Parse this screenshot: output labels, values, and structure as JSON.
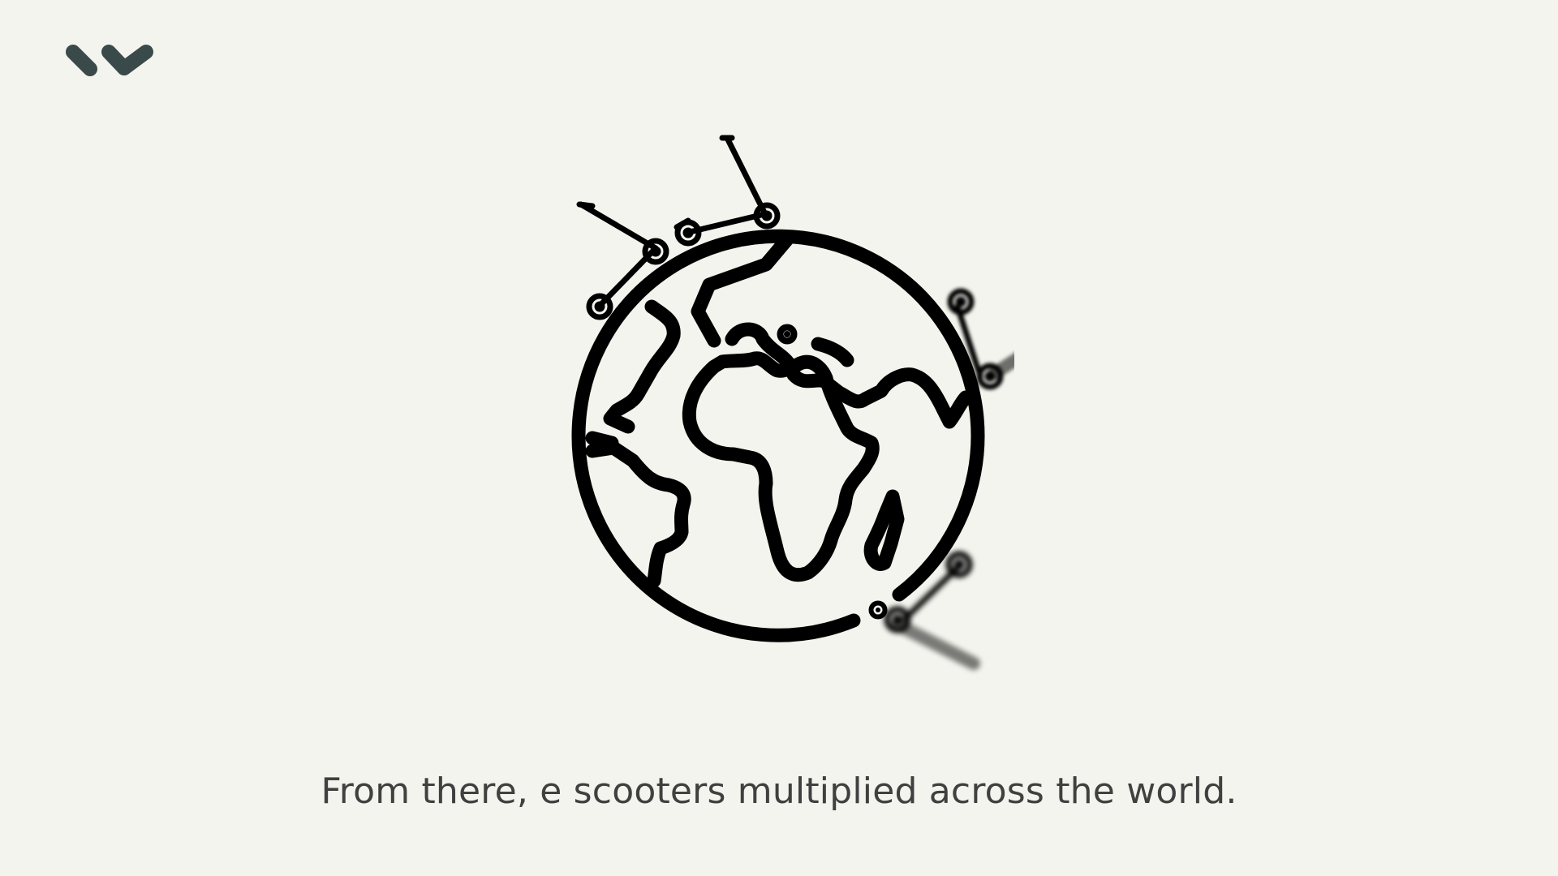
{
  "brand": {
    "logo_icon": "w-chevron-logo-icon",
    "color": "#3a4a4a"
  },
  "illustration": {
    "globe_icon": "earth-globe-icon",
    "scooter_icon": "e-scooter-icon",
    "scooter_count": 4,
    "stroke_color": "#000000"
  },
  "caption": {
    "text": "From there, e scooters multiplied across the world."
  },
  "theme": {
    "background": "#f4f4ee",
    "text_color": "#404040"
  }
}
